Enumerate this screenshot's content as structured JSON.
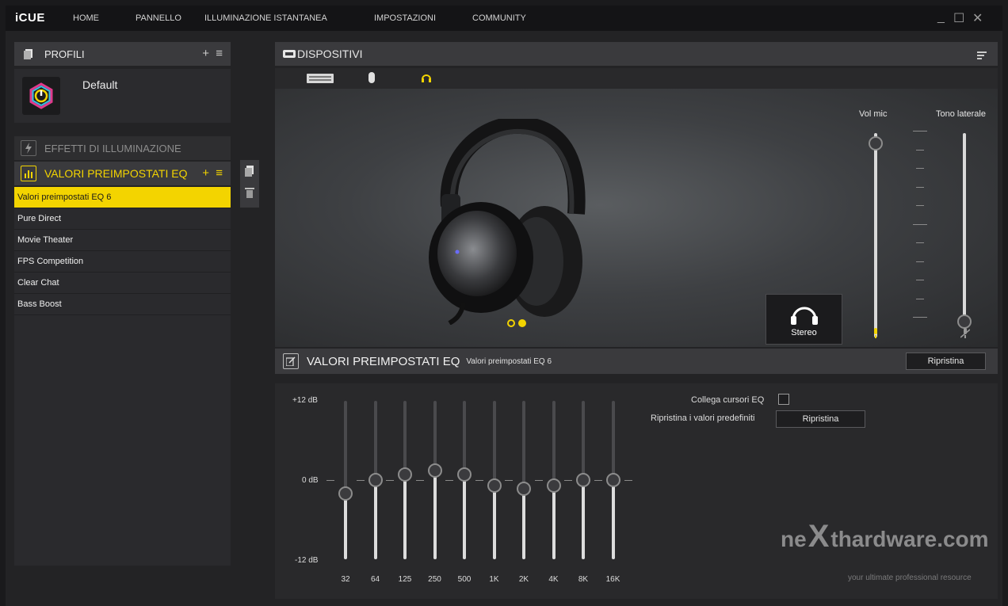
{
  "app": {
    "brand": "iCUE"
  },
  "nav": {
    "items": [
      "HOME",
      "PANNELLO",
      "ILLUMINAZIONE ISTANTANEA",
      "IMPOSTAZIONI",
      "COMMUNITY"
    ]
  },
  "window_controls": {
    "minimize": "_",
    "maximize": "☐",
    "close": "✕"
  },
  "profiles": {
    "title": "PROFILI",
    "add": "+",
    "menu": "≡",
    "profile_name": "Default"
  },
  "lighting": {
    "title": "EFFETTI DI ILLUMINAZIONE"
  },
  "eq_presets": {
    "title": "VALORI PREIMPOSTATI EQ",
    "add": "+",
    "menu": "≡",
    "items": [
      "Valori preimpostati EQ 6",
      "Pure Direct",
      "Movie Theater",
      "FPS Competition",
      "Clear Chat",
      "Bass Boost"
    ],
    "selected_index": 0
  },
  "devices": {
    "title": "DISPOSITIVI",
    "tabs": [
      "keyboard-icon",
      "mouse-icon",
      "headset-icon"
    ]
  },
  "volume": {
    "mic_label": "Vol mic",
    "sidetone_label": "Tono laterale",
    "mic_level": 0.95,
    "sidetone_level": 0.0
  },
  "stereo": {
    "label": "Stereo"
  },
  "carousel": {
    "pages": 2,
    "active": 1
  },
  "eq": {
    "title": "VALORI PREIMPOSTATI EQ",
    "preset_name": "Valori preimpostati EQ 6",
    "reset_button": "Ripristina",
    "db_top": "+12 dB",
    "db_mid": "0 dB",
    "db_bottom": "-12 dB",
    "bands": [
      "32",
      "64",
      "125",
      "250",
      "500",
      "1K",
      "2K",
      "4K",
      "8K",
      "16K"
    ],
    "gains_db": [
      -2.0,
      0.0,
      0.8,
      1.5,
      0.8,
      -0.8,
      -1.3,
      -0.8,
      0.0,
      0.0
    ],
    "link_label": "Collega cursori EQ",
    "link_checked": false,
    "restore_label": "Ripristina i valori predefiniti",
    "restore_button": "Ripristina"
  },
  "watermark": {
    "text": "nexthardware.com",
    "tagline": "your ultimate professional resource"
  },
  "colors": {
    "accent": "#f3d400",
    "panel": "#3a3a3d",
    "background": "#232325"
  }
}
